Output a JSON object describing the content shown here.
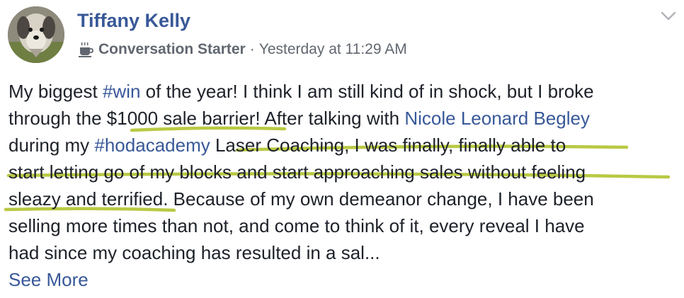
{
  "post": {
    "author": "Tiffany Kelly",
    "badge_icon": "coffee-cup-icon",
    "badge_label": "Conversation Starter",
    "separator": "·",
    "timestamp": "Yesterday at 11:29 AM",
    "menu_icon": "chevron-down-icon",
    "lines": [
      [
        {
          "t": "My biggest "
        },
        {
          "t": "#win",
          "link": true
        },
        {
          "t": " of the year! I think I am still kind of in shock, but I broke"
        }
      ],
      [
        {
          "t": "through the $1000 sale barrier! After talking with "
        },
        {
          "t": "Nicole Leonard Begley",
          "link": true
        }
      ],
      [
        {
          "t": "during my "
        },
        {
          "t": "#hodacademy",
          "link": true
        },
        {
          "t": " Laser Coaching, I was finally, finally able to"
        }
      ],
      [
        {
          "t": "start letting go of my blocks and start approaching sales without feeling"
        }
      ],
      [
        {
          "t": "sleazy and terrified. Because of my own demeanor change, I have been"
        }
      ],
      [
        {
          "t": "selling more times than not, and come to think of it, every reveal I have"
        }
      ],
      [
        {
          "t": "had since my coaching has resulted in a sal..."
        }
      ]
    ],
    "see_more": "See More"
  },
  "colors": {
    "link": "#385898",
    "text": "#1d2129",
    "meta": "#616770",
    "highlight": "#b5c63a"
  }
}
